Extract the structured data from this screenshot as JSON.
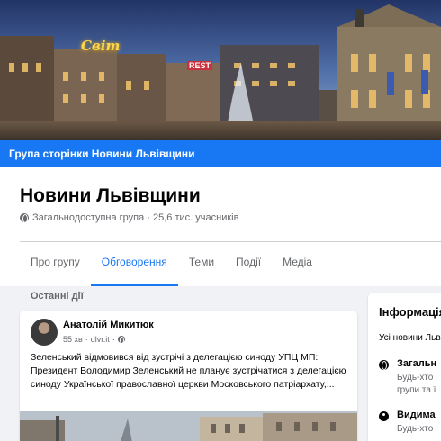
{
  "cover": {
    "sign_left": "Світ",
    "sign_mid": "REST"
  },
  "group_bar": {
    "label": "Група сторінки Новини Львівщини"
  },
  "header": {
    "title": "Новини Львівщини",
    "meta": "Загальнодоступна група · 25,6 тис. учасників",
    "meta_icon": "globe-icon"
  },
  "tabs": [
    {
      "label": "Про групу",
      "active": false
    },
    {
      "label": "Обговорення",
      "active": true
    },
    {
      "label": "Теми",
      "active": false
    },
    {
      "label": "Події",
      "active": false
    },
    {
      "label": "Медіа",
      "active": false
    }
  ],
  "colors": {
    "accent": "#1877f2",
    "page_bg": "#f0f2f5",
    "secondary_text": "#65676b"
  },
  "feed": {
    "section_label": "Останні дії",
    "post": {
      "author": "Анатолій Микитюк",
      "time": "55 хв",
      "source": "dlvr.it",
      "text": "Зеленський відмовився від зустрічі з делегацією синоду УПЦ МП: Президент Володимир Зеленський не планує зустрічатися з делегацією синоду Української православної церкви Московського патріархату,..."
    }
  },
  "info": {
    "title": "Інформація",
    "desc": "Усі новини Льв",
    "rows": [
      {
        "icon": "globe-icon",
        "title": "Загальн",
        "sub1": "Будь-хто",
        "sub2": "групи та ї"
      },
      {
        "icon": "eye-icon",
        "title": "Видима",
        "sub1": "Будь-хто"
      }
    ]
  }
}
